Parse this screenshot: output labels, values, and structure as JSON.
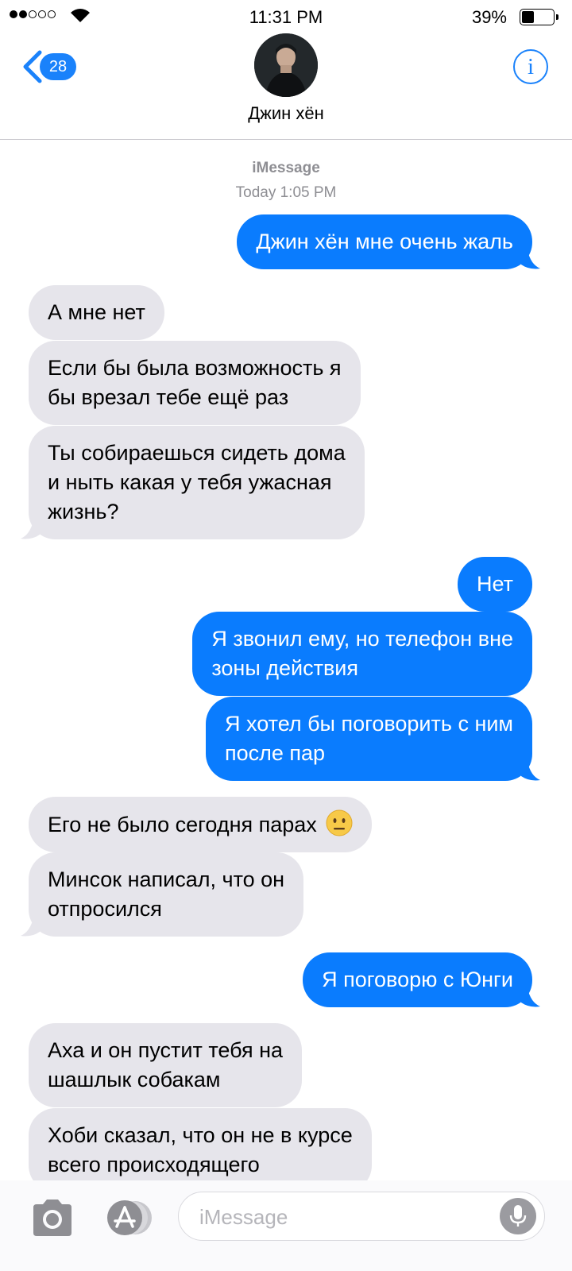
{
  "status_bar": {
    "time": "11:31 PM",
    "battery_percent": "39%",
    "battery_level": 0.39,
    "signal_bars": 2,
    "signal_total": 5
  },
  "header": {
    "back_count": "28",
    "contact_name": "Джин хён"
  },
  "thread": {
    "service": "iMessage",
    "timestamp": "Today 1:05 PM"
  },
  "messages": [
    {
      "from": "me",
      "lines": [
        "Джин хён мне очень жаль"
      ]
    },
    {
      "from": "them",
      "lines": [
        "А мне нет"
      ]
    },
    {
      "from": "them",
      "lines": [
        "Если бы была возможность я",
        "бы врезал тебе ещё раз"
      ]
    },
    {
      "from": "them",
      "lines": [
        "Ты собираешься сидеть дома",
        "и ныть какая у тебя ужасная",
        "жизнь?"
      ]
    },
    {
      "from": "me",
      "lines": [
        "Нет"
      ]
    },
    {
      "from": "me",
      "lines": [
        "Я звонил ему, но телефон вне",
        "зоны действия"
      ]
    },
    {
      "from": "me",
      "lines": [
        "Я хотел бы поговорить с ним",
        "после пар"
      ]
    },
    {
      "from": "them",
      "lines": [
        "Его не было сегодня парах"
      ],
      "emoji": "neutral-face"
    },
    {
      "from": "them",
      "lines": [
        "Минсок написал, что он",
        "отпросился"
      ]
    },
    {
      "from": "me",
      "lines": [
        "Я поговорю с Юнги"
      ]
    },
    {
      "from": "them",
      "lines": [
        "Аха и он пустит тебя на",
        "шашлык собакам"
      ]
    },
    {
      "from": "them",
      "lines": [
        "Хоби сказал, что он не в курсе",
        "всего происходящего"
      ]
    }
  ],
  "input": {
    "placeholder": "iMessage"
  },
  "colors": {
    "outgoing": "#0a7cfe",
    "incoming": "#e6e5eb",
    "accent": "#1a82fb"
  }
}
